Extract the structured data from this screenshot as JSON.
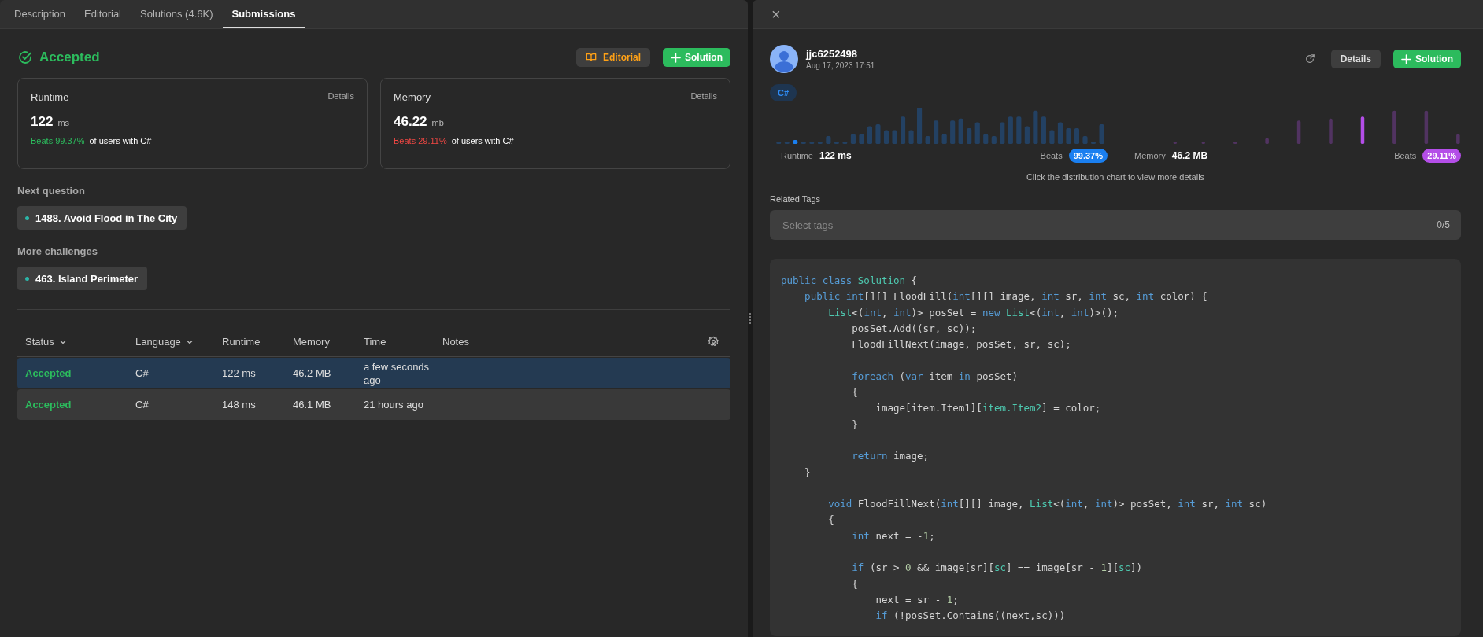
{
  "left_panel": {
    "tabs": [
      {
        "label": "Description",
        "selected": false
      },
      {
        "label": "Editorial",
        "selected": false
      },
      {
        "label": "Solutions (4.6K)",
        "selected": false
      },
      {
        "label": "Submissions",
        "selected": true
      }
    ],
    "result": {
      "status": "Accepted",
      "editorial_button": "Editorial",
      "solution_button": "Solution"
    },
    "metrics": [
      {
        "title": "Runtime",
        "details": "Details",
        "value": "122",
        "unit": "ms",
        "beats": "Beats 99.37%",
        "beats_good": true,
        "suffix": "of users with C#"
      },
      {
        "title": "Memory",
        "details": "Details",
        "value": "46.22",
        "unit": "mb",
        "beats": "Beats 29.11%",
        "beats_good": false,
        "suffix": "of users with C#"
      }
    ],
    "next_question": {
      "label": "Next question",
      "items": [
        "1488. Avoid Flood in The City"
      ]
    },
    "more_challenges": {
      "label": "More challenges",
      "items": [
        "463. Island Perimeter"
      ]
    },
    "table": {
      "columns": [
        {
          "label": "Status",
          "sortable": true
        },
        {
          "label": "Language",
          "sortable": true
        },
        {
          "label": "Runtime",
          "sortable": false
        },
        {
          "label": "Memory",
          "sortable": false
        },
        {
          "label": "Time",
          "sortable": false
        },
        {
          "label": "Notes",
          "sortable": false
        }
      ],
      "rows": [
        {
          "selected": true,
          "status": "Accepted",
          "language": "C#",
          "runtime": "122 ms",
          "memory": "46.2 MB",
          "time": "a few seconds ago"
        },
        {
          "selected": false,
          "status": "Accepted",
          "language": "C#",
          "runtime": "148 ms",
          "memory": "46.1 MB",
          "time": "21 hours ago"
        }
      ]
    }
  },
  "right_panel": {
    "close": "×",
    "user": {
      "name": "jjc6252498",
      "date": "Aug 17, 2023 17:51"
    },
    "details_button": "Details",
    "solution_button": "Solution",
    "language": "C#",
    "stats": [
      {
        "label": "Runtime",
        "value": "122 ms",
        "beats_label": "Beats",
        "beats": "99.37%",
        "color": "#1a7ff0"
      },
      {
        "label": "Memory",
        "value": "46.2 MB",
        "beats_label": "Beats",
        "beats": "29.11%",
        "color": "#b44ee8"
      }
    ],
    "chart_hint": "Click the distribution chart to view more details",
    "related_tags": {
      "label": "Related Tags",
      "placeholder": "Select tags",
      "count": "0/5"
    },
    "code": [
      {
        "kind": "code",
        "tokens": [
          {
            "text": "public class ",
            "kind": "kw"
          },
          {
            "text": "Solution",
            "kind": "type"
          },
          {
            "text": " {",
            "kind": "plain"
          }
        ]
      },
      {
        "kind": "code",
        "tokens": [
          {
            "text": "    public int",
            "kind": "kw"
          },
          {
            "text": "[][] FloodFill(",
            "kind": "plain"
          },
          {
            "text": "int",
            "kind": "kw"
          },
          {
            "text": "[][] image, ",
            "kind": "plain"
          },
          {
            "text": "int",
            "kind": "kw"
          },
          {
            "text": " sr, ",
            "kind": "plain"
          },
          {
            "text": "int",
            "kind": "kw"
          },
          {
            "text": " sc, ",
            "kind": "plain"
          },
          {
            "text": "int",
            "kind": "kw"
          },
          {
            "text": " color) {",
            "kind": "plain"
          }
        ]
      },
      {
        "kind": "code",
        "tokens": [
          {
            "text": "        List",
            "kind": "type"
          },
          {
            "text": "<(",
            "kind": "plain"
          },
          {
            "text": "int",
            "kind": "kw"
          },
          {
            "text": ", ",
            "kind": "plain"
          },
          {
            "text": "int",
            "kind": "kw"
          },
          {
            "text": ")> posSet = ",
            "kind": "plain"
          },
          {
            "text": "new",
            "kind": "kw"
          },
          {
            "text": " List",
            "kind": "type"
          },
          {
            "text": "<(",
            "kind": "plain"
          },
          {
            "text": "int",
            "kind": "kw"
          },
          {
            "text": ", ",
            "kind": "plain"
          },
          {
            "text": "int",
            "kind": "kw"
          },
          {
            "text": ")>();",
            "kind": "plain"
          }
        ]
      },
      {
        "kind": "code",
        "tokens": [
          {
            "text": "            posSet.Add((sr, sc));",
            "kind": "plain"
          }
        ]
      },
      {
        "kind": "code",
        "tokens": [
          {
            "text": "            FloodFillNext(image, posSet, sr, sc);",
            "kind": "plain"
          }
        ]
      },
      {
        "kind": "blank"
      },
      {
        "kind": "code",
        "tokens": [
          {
            "text": "            foreach",
            "kind": "kw"
          },
          {
            "text": " (",
            "kind": "plain"
          },
          {
            "text": "var",
            "kind": "kw"
          },
          {
            "text": " item ",
            "kind": "plain"
          },
          {
            "text": "in",
            "kind": "kw"
          },
          {
            "text": " posSet)",
            "kind": "plain"
          }
        ]
      },
      {
        "kind": "code",
        "tokens": [
          {
            "text": "            {",
            "kind": "plain"
          }
        ]
      },
      {
        "kind": "code",
        "tokens": [
          {
            "text": "                image[item.Item1][",
            "kind": "plain"
          },
          {
            "text": "item.Item2",
            "kind": "type"
          },
          {
            "text": "] = color;",
            "kind": "plain"
          }
        ]
      },
      {
        "kind": "code",
        "tokens": [
          {
            "text": "            }",
            "kind": "plain"
          }
        ]
      },
      {
        "kind": "blank"
      },
      {
        "kind": "code",
        "tokens": [
          {
            "text": "            return",
            "kind": "kw"
          },
          {
            "text": " image;",
            "kind": "plain"
          }
        ]
      },
      {
        "kind": "code",
        "tokens": [
          {
            "text": "    }",
            "kind": "plain"
          }
        ]
      },
      {
        "kind": "blank"
      },
      {
        "kind": "code",
        "tokens": [
          {
            "text": "        void",
            "kind": "kw"
          },
          {
            "text": " FloodFillNext(",
            "kind": "plain"
          },
          {
            "text": "int",
            "kind": "kw"
          },
          {
            "text": "[][] image, ",
            "kind": "plain"
          },
          {
            "text": "List",
            "kind": "type"
          },
          {
            "text": "<(",
            "kind": "plain"
          },
          {
            "text": "int",
            "kind": "kw"
          },
          {
            "text": ", ",
            "kind": "plain"
          },
          {
            "text": "int",
            "kind": "kw"
          },
          {
            "text": ")> posSet, ",
            "kind": "plain"
          },
          {
            "text": "int",
            "kind": "kw"
          },
          {
            "text": " sr, ",
            "kind": "plain"
          },
          {
            "text": "int",
            "kind": "kw"
          },
          {
            "text": " sc)",
            "kind": "plain"
          }
        ]
      },
      {
        "kind": "code",
        "tokens": [
          {
            "text": "        {",
            "kind": "plain"
          }
        ]
      },
      {
        "kind": "code",
        "tokens": [
          {
            "text": "            int",
            "kind": "kw"
          },
          {
            "text": " next = -",
            "kind": "plain"
          },
          {
            "text": "1",
            "kind": "num"
          },
          {
            "text": ";",
            "kind": "plain"
          }
        ]
      },
      {
        "kind": "blank"
      },
      {
        "kind": "code",
        "tokens": [
          {
            "text": "            if",
            "kind": "kw"
          },
          {
            "text": " (sr > ",
            "kind": "plain"
          },
          {
            "text": "0",
            "kind": "num"
          },
          {
            "text": " && image[sr][",
            "kind": "plain"
          },
          {
            "text": "sc",
            "kind": "type"
          },
          {
            "text": "] == image[sr - ",
            "kind": "plain"
          },
          {
            "text": "1",
            "kind": "num"
          },
          {
            "text": "][",
            "kind": "plain"
          },
          {
            "text": "sc",
            "kind": "type"
          },
          {
            "text": "])",
            "kind": "plain"
          }
        ]
      },
      {
        "kind": "code",
        "tokens": [
          {
            "text": "            {",
            "kind": "plain"
          }
        ]
      },
      {
        "kind": "code",
        "tokens": [
          {
            "text": "                next = sr - ",
            "kind": "plain"
          },
          {
            "text": "1",
            "kind": "num"
          },
          {
            "text": ";",
            "kind": "plain"
          }
        ]
      },
      {
        "kind": "code",
        "tokens": [
          {
            "text": "                if",
            "kind": "kw"
          },
          {
            "text": " (!posSet.Contains((next,sc)))",
            "kind": "plain"
          }
        ]
      }
    ]
  }
}
